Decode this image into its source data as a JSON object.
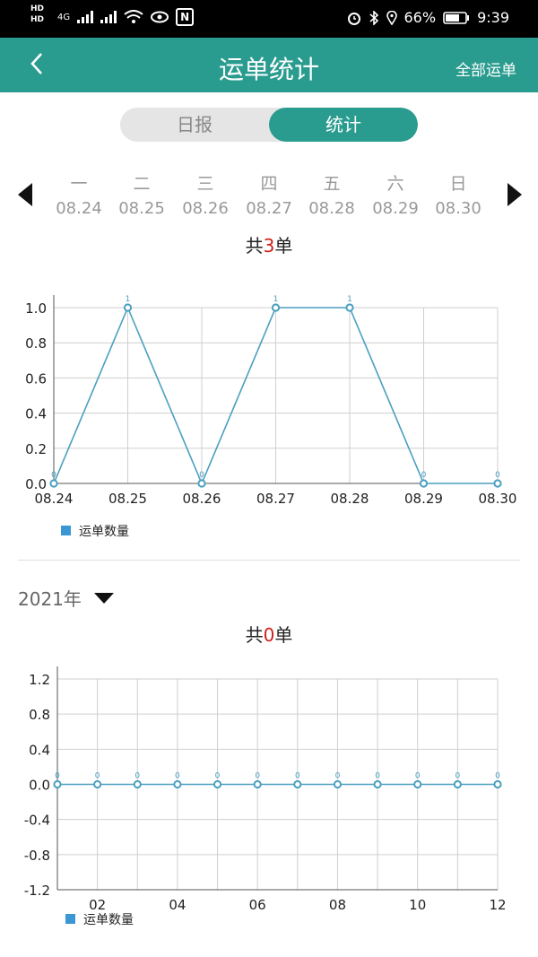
{
  "status_bar": {
    "network": "4G",
    "battery": "66%",
    "time": "9:39",
    "nfc": "N"
  },
  "header": {
    "title": "运单统计",
    "right_action": "全部运单"
  },
  "tabs": [
    {
      "label": "日报",
      "active": false
    },
    {
      "label": "统计",
      "active": true
    }
  ],
  "week": {
    "days": [
      {
        "weekday": "一",
        "date": "08.24"
      },
      {
        "weekday": "二",
        "date": "08.25"
      },
      {
        "weekday": "三",
        "date": "08.26"
      },
      {
        "weekday": "四",
        "date": "08.27"
      },
      {
        "weekday": "五",
        "date": "08.28"
      },
      {
        "weekday": "六",
        "date": "08.29"
      },
      {
        "weekday": "日",
        "date": "08.30"
      }
    ]
  },
  "weekly_summary": {
    "prefix": "共",
    "count": "3",
    "suffix": "单"
  },
  "year_selector": {
    "value": "2021年"
  },
  "yearly_summary": {
    "prefix": "共",
    "count": "0",
    "suffix": "单"
  },
  "colors": {
    "accent": "#2a9c8f",
    "line": "#4a9fc0",
    "legend": "#3a97d4",
    "count_highlight": "#d0201a"
  },
  "chart_data": [
    {
      "type": "line",
      "x": [
        "08.24",
        "08.25",
        "08.26",
        "08.27",
        "08.28",
        "08.29",
        "08.30"
      ],
      "series": [
        {
          "name": "运单数量",
          "values": [
            0,
            1,
            0,
            1,
            1,
            0,
            0
          ]
        }
      ],
      "data_labels": [
        "0",
        "1",
        "0",
        "1",
        "1",
        "0",
        "0"
      ],
      "yticks": [
        "0.0",
        "0.2",
        "0.4",
        "0.6",
        "0.8",
        "1.0"
      ],
      "ylim": [
        0,
        1
      ],
      "grid": true,
      "legend_position": "bottom-left"
    },
    {
      "type": "line",
      "x": [
        "01",
        "02",
        "03",
        "04",
        "05",
        "06",
        "07",
        "08",
        "09",
        "10",
        "11",
        "12"
      ],
      "xticks": [
        "02",
        "04",
        "06",
        "08",
        "10",
        "12"
      ],
      "series": [
        {
          "name": "运单数量",
          "values": [
            0,
            0,
            0,
            0,
            0,
            0,
            0,
            0,
            0,
            0,
            0,
            0
          ]
        }
      ],
      "data_labels": [
        "0",
        "0",
        "0",
        "0",
        "0",
        "0",
        "0",
        "0",
        "0",
        "0",
        "0",
        "0"
      ],
      "yticks": [
        "-1.2",
        "-0.8",
        "-0.4",
        "0.0",
        "0.4",
        "0.8",
        "1.2"
      ],
      "ylim": [
        -1.2,
        1.2
      ],
      "grid": true,
      "legend_position": "bottom-left"
    }
  ]
}
